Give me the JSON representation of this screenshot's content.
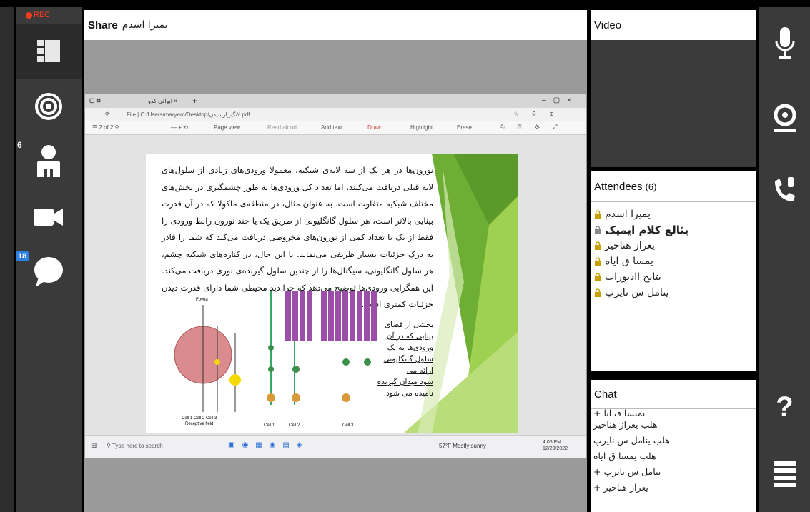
{
  "recording": {
    "label": "REC"
  },
  "left_toolbar": {
    "participants_count": "6",
    "chat_unread": "18"
  },
  "share": {
    "title": "Share",
    "owner": "یمیرا اسدم"
  },
  "browser": {
    "tab_label": "ابوالی کدو",
    "url": "File | C:/Users/maryam/Desktop/لانگ_ارسیدن.pdf",
    "toolbar": {
      "page_view": "Page view",
      "read_aloud": "Read aloud",
      "add_text": "Add text",
      "draw": "Draw",
      "highlight": "Highlight",
      "erase": "Erase"
    },
    "taskbar_search": "Type here to search",
    "taskbar_weather": "57°F Mostly sunny",
    "taskbar_time": "4:06 PM",
    "taskbar_date": "12/20/2022"
  },
  "slide": {
    "paragraph": "نورون‌ها در هر یک از سه لایه‌ی شبکیه، معمولا ورودی‌های زیادی از سلول‌های لایه قبلی دریافت می‌کنند، اما تعداد کل ورودی‌ها به طور چشمگیری در بخش‌های مختلف شبکیه متفاوت است. به عنوان مثال، در منطقه‌ی ماکولا که در آن قدرت بینایی بالاتر است، هر سلول گانگلیونی از طریق یک یا چند نورون رابط ورودی را فقط از یک یا تعداد کمی از نورون‌های مخروطی دریافت می‌کند که شما را قادر به درک جزئیات بسیار ظریفی می‌نماید. با این حال، در کناره‌های شبکیه چشم، هر سلول گانگلیونی، سیگنال‌ها را از چندین سلول گیرنده‌ی نوری دریافت می‌کند. این همگرایی ورودی‌ها توضیح می‌دهد که چرا دید محیطی شما دارای قدرت دیدن جزئیات کمتری است.",
    "caption_lines": [
      "بخشی از فضای",
      "بینایی که در آن",
      "ورودی‌ها به یک",
      "سلول گانگلیونی",
      "ارائه می",
      "شود میدان گیرنده",
      "نامیده می شود."
    ],
    "figure_labels": {
      "fovea": "Fovea",
      "cells": "Cell 1  Cell 2  Cell 3",
      "receptive_field": "Receptive field",
      "cell1": "Cell 1",
      "cell2": "Cell 2",
      "cell3": "Cell 3"
    }
  },
  "video": {
    "title": "Video"
  },
  "attendees": {
    "title": "Attendees",
    "count": "(6)",
    "items": [
      {
        "name": "یمیرا اسدم",
        "bold": false
      },
      {
        "name": "یئالع کلام ایمیک",
        "bold": true
      },
      {
        "name": "یعراز هناحیر",
        "bold": false
      },
      {
        "name": "یمسا ق ایاه",
        "bold": false
      },
      {
        "name": "یتایح اادیوراب",
        "bold": false
      },
      {
        "name": "ینامل س نایرپ",
        "bold": false
      }
    ]
  },
  "chat": {
    "title": "Chat",
    "messages": [
      "+ یمیسا ق ایا",
      "هلب یعراز هناحیر",
      "هلب ینامل س نایرپ",
      "هلب یمسا ق ایاه",
      "+ ینامل س نایرپ",
      "+ یعراز هناحیر"
    ]
  },
  "right_toolbar": {
    "help_label": "?"
  },
  "colors": {
    "toolbar_bg": "#3a3a3a",
    "share_bg": "#9a9a9a",
    "rec_red": "#ff3b1f",
    "badge_blue": "#2f7fe0",
    "slide_green": "#8cc63f"
  }
}
